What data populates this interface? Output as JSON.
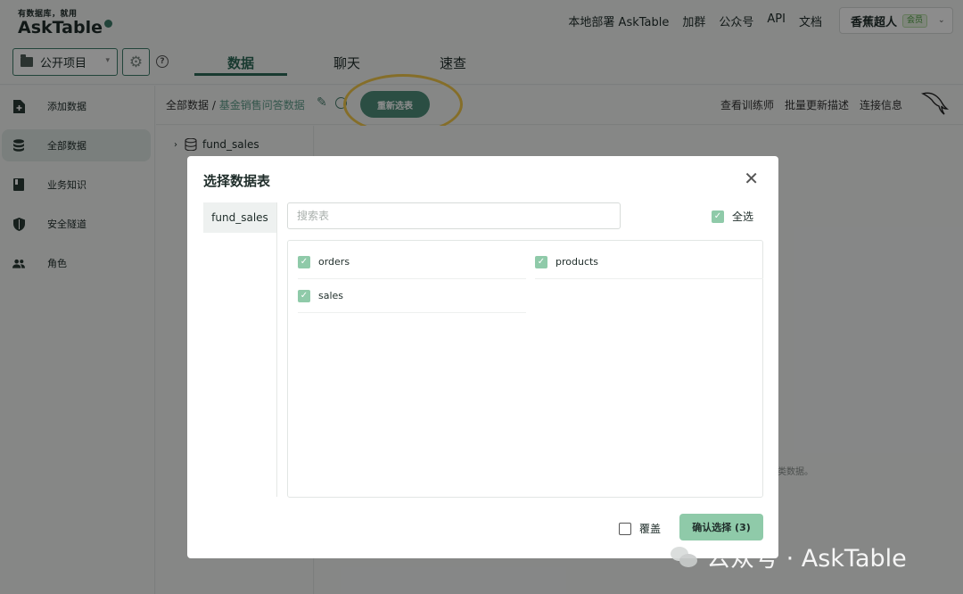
{
  "header": {
    "logo_tagline": "有数据库，就用",
    "logo_brand": "AskTable",
    "nav": [
      "本地部署 AskTable",
      "加群",
      "公众号",
      "API",
      "文档"
    ],
    "user_name": "香蕉超人",
    "user_badge": "会员"
  },
  "toolbar": {
    "project_select": "公开项目",
    "tabs": [
      "数据",
      "聊天",
      "速查"
    ]
  },
  "sidebar": {
    "items": [
      {
        "label": "添加数据",
        "icon": "file-add-icon"
      },
      {
        "label": "全部数据",
        "icon": "database-icon"
      },
      {
        "label": "业务知识",
        "icon": "book-icon"
      },
      {
        "label": "安全隧道",
        "icon": "shield-icon"
      },
      {
        "label": "角色",
        "icon": "users-icon"
      }
    ]
  },
  "content": {
    "breadcrumb_root": "全部数据",
    "breadcrumb_sep": "/",
    "breadcrumb_current": "基金销售问答数据",
    "reselect_button": "重新选表",
    "header_links": [
      "查看训练师",
      "批量更新描述",
      "连接信息"
    ],
    "tree_db": "fund_sales",
    "behind_hint": "类数据。"
  },
  "modal": {
    "title": "选择数据表",
    "databases": [
      "fund_sales"
    ],
    "search_placeholder": "搜索表",
    "select_all_label": "全选",
    "tables": [
      {
        "name": "orders",
        "checked": true
      },
      {
        "name": "products",
        "checked": true
      },
      {
        "name": "sales",
        "checked": true
      }
    ],
    "overwrite_label": "覆盖",
    "confirm_button": "确认选择 (3)"
  },
  "watermark": {
    "text": "公众号 · AskTable"
  },
  "colors": {
    "accent": "#2f6a58",
    "button": "#4f8f7b",
    "checkbox": "#8fcaa9",
    "highlight": "#f2c94c"
  }
}
